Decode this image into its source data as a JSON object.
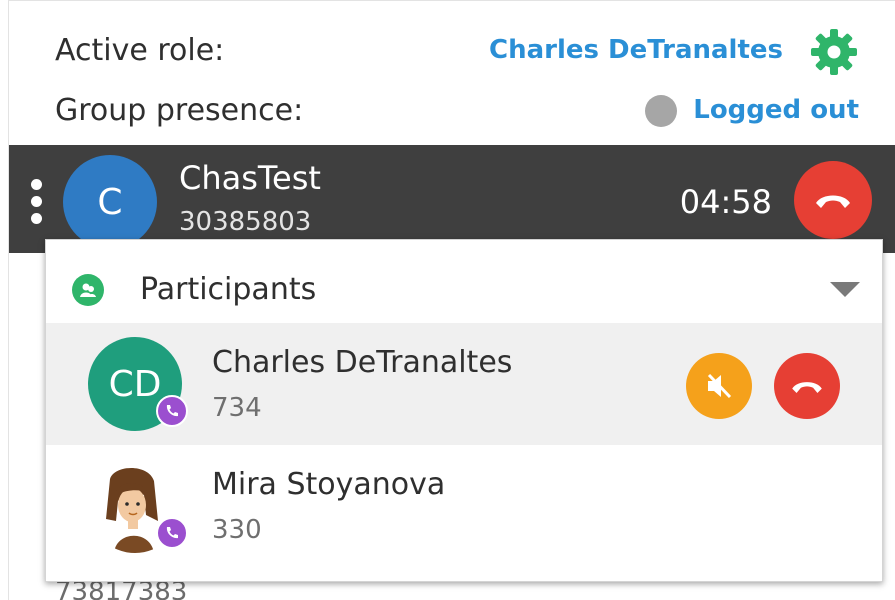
{
  "header": {
    "active_role_label": "Active role:",
    "active_role_name": "Charles DeTranaltes",
    "settings_icon": "gear-icon",
    "group_presence_label": "Group presence:",
    "presence_status": "Logged out",
    "presence_color": "#a6a6a6"
  },
  "active_call": {
    "avatar_initial": "C",
    "name": "ChasTest",
    "number": "30385803",
    "timer": "04:58",
    "avatar_color": "#2f7bc4",
    "hangup_color": "#e63f34"
  },
  "participants": {
    "title": "Participants",
    "items": [
      {
        "initials": "CD",
        "name": "Charles DeTranaltes",
        "extension": "734",
        "avatar_color": "#1f9e7d",
        "mute_color": "#f5a11b"
      },
      {
        "initials": "",
        "name": "Mira Stoyanova",
        "extension": "330"
      }
    ]
  },
  "behind": {
    "number": "73817383"
  },
  "colors": {
    "link_blue": "#2a8fd6",
    "accent_green": "#2fb56a",
    "badge_purple": "#9b4fcf",
    "call_bar": "#3f3f3f"
  }
}
